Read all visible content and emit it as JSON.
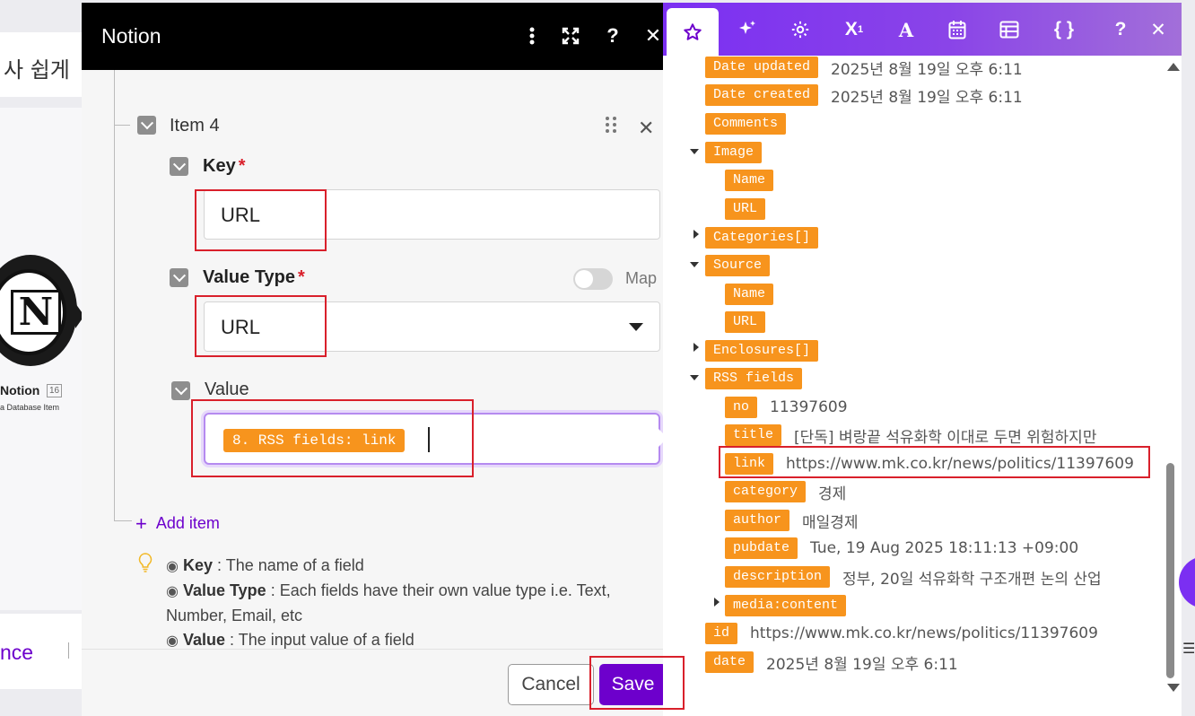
{
  "background": {
    "top_card_text": "사 쉽게",
    "node_letter": "N",
    "node_label": "Notion",
    "node_badge": "16",
    "node_sub": "a Database Item",
    "bottom_text": "nce"
  },
  "panel": {
    "title": "Notion",
    "header_icons": [
      "more-vertical-icon",
      "expand-icon",
      "help-icon",
      "close-icon"
    ],
    "item_label": "Item 4",
    "key": {
      "label": "Key",
      "required_mark": "*",
      "value": "URL"
    },
    "value_type": {
      "label": "Value Type",
      "required_mark": "*",
      "selected": "URL",
      "map_label": "Map",
      "map_enabled": false
    },
    "value": {
      "label": "Value",
      "mapped_pill": "8. RSS fields: link"
    },
    "add_item": "Add item",
    "help": {
      "line1_term": "Key",
      "line1_desc": " : The name of a field",
      "line2_term": "Value Type",
      "line2_desc": " : Each fields have their own value type i.e. Text, Number, Email, etc",
      "line3_term": "Value",
      "line3_desc": " : The input value of a field"
    },
    "cancel_label": "Cancel",
    "save_label": "Save"
  },
  "mapping": {
    "toolbar_icons": [
      "star-icon",
      "sparkle-icon",
      "gear-icon",
      "superscript-icon",
      "text-icon",
      "calendar-icon",
      "table-icon",
      "braces-icon",
      "help-icon",
      "close-icon"
    ],
    "rows": [
      {
        "tag": "Date updated",
        "value": "2025년 8월 19일 오후 6:11"
      },
      {
        "tag": "Date created",
        "value": "2025년 8월 19일 오후 6:11"
      },
      {
        "tag": "Comments",
        "value": ""
      },
      {
        "tag": "Image",
        "value": ""
      },
      {
        "tag": "Name",
        "value": ""
      },
      {
        "tag": "URL",
        "value": ""
      },
      {
        "tag": "Categories[]",
        "value": ""
      },
      {
        "tag": "Source",
        "value": ""
      },
      {
        "tag": "Name",
        "value": ""
      },
      {
        "tag": "URL",
        "value": ""
      },
      {
        "tag": "Enclosures[]",
        "value": ""
      },
      {
        "tag": "RSS fields",
        "value": ""
      },
      {
        "tag": "no",
        "value": "11397609"
      },
      {
        "tag": "title",
        "value": "[단독] 벼랑끝 석유화학 이대로 두면 위험하지만"
      },
      {
        "tag": "link",
        "value": "https://www.mk.co.kr/news/politics/11397609"
      },
      {
        "tag": "category",
        "value": "경제"
      },
      {
        "tag": "author",
        "value": "매일경제"
      },
      {
        "tag": "pubdate",
        "value": "Tue, 19 Aug 2025 18:11:13 +09:00"
      },
      {
        "tag": "description",
        "value": "정부, 20일 석유화학 구조개편 논의 산업"
      },
      {
        "tag": "media:content",
        "value": ""
      },
      {
        "tag": "id",
        "value": "https://www.mk.co.kr/news/politics/11397609"
      },
      {
        "tag": "date",
        "value": "2025년 8월 19일 오후 6:11"
      }
    ]
  },
  "colors": {
    "accent": "#6d00cc",
    "tag": "#f7941d",
    "annotation": "#d9202b",
    "header": "#000000"
  }
}
